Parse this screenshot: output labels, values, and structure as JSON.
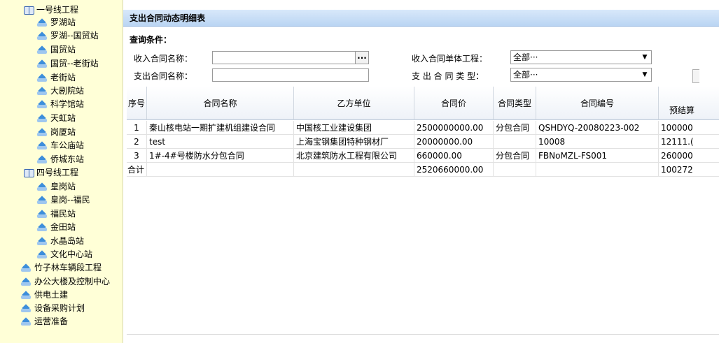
{
  "tree": {
    "items": [
      {
        "label": "一号线工程",
        "type": "folder",
        "level": 0
      },
      {
        "label": "罗湖站",
        "type": "item",
        "level": 1
      },
      {
        "label": "罗湖--国贸站",
        "type": "item",
        "level": 1
      },
      {
        "label": "国贸站",
        "type": "item",
        "level": 1
      },
      {
        "label": "国贸--老街站",
        "type": "item",
        "level": 1
      },
      {
        "label": "老街站",
        "type": "item",
        "level": 1
      },
      {
        "label": "大剧院站",
        "type": "item",
        "level": 1
      },
      {
        "label": "科学馆站",
        "type": "item",
        "level": 1
      },
      {
        "label": "天虹站",
        "type": "item",
        "level": 1
      },
      {
        "label": "岗厦站",
        "type": "item",
        "level": 1
      },
      {
        "label": "车公庙站",
        "type": "item",
        "level": 1
      },
      {
        "label": "侨城东站",
        "type": "item",
        "level": 1
      },
      {
        "label": "四号线工程",
        "type": "folder",
        "level": 0
      },
      {
        "label": "皇岗站",
        "type": "item",
        "level": 1
      },
      {
        "label": "皇岗--福民",
        "type": "item",
        "level": 1
      },
      {
        "label": "福民站",
        "type": "item",
        "level": 1
      },
      {
        "label": "金田站",
        "type": "item",
        "level": 1
      },
      {
        "label": "水晶岛站",
        "type": "item",
        "level": 1
      },
      {
        "label": "文化中心站",
        "type": "item",
        "level": 1
      },
      {
        "label": "竹子林车辆段工程",
        "type": "item",
        "level": 0
      },
      {
        "label": "办公大楼及控制中心",
        "type": "item",
        "level": 0
      },
      {
        "label": "供电土建",
        "type": "item",
        "level": 0
      },
      {
        "label": "设备采购计划",
        "type": "item",
        "level": 0
      },
      {
        "label": "运营准备",
        "type": "item",
        "level": 0
      }
    ]
  },
  "panel": {
    "title": "支出合同动态明细表",
    "query_title": "查询条件：",
    "income_contract_name_label": "收入合同名称：",
    "income_contract_name_value": "",
    "browse_button_label": "...",
    "expense_contract_name_label": "支出合同名称：",
    "expense_contract_name_value": "",
    "income_single_project_label": "收入合同单体工程：",
    "income_single_project_value": "全部···",
    "contract_type_label": "支 出 合 同 类 型：",
    "contract_type_value": "全部···"
  },
  "table": {
    "headers": [
      "序号",
      "合同名称",
      "乙方单位",
      "合同价",
      "合同类型",
      "合同编号",
      "预结算"
    ],
    "rows": [
      [
        "1",
        "秦山核电站一期扩建机组建设合同",
        "中国核工业建设集团",
        "2500000000.00",
        "分包合同",
        "QSHDYQ-20080223-002",
        "100000"
      ],
      [
        "2",
        "test",
        "上海宝钢集团特种钢材厂",
        "20000000.00",
        "",
        "10008",
        "12111.("
      ],
      [
        "3",
        "1#-4#号楼防水分包合同",
        "北京建筑防水工程有限公司",
        "660000.00",
        "分包合同",
        "FBNoMZL-FS001",
        "260000"
      ]
    ],
    "total": [
      "合计",
      "",
      "",
      "2520660000.00",
      "",
      "",
      "100272"
    ]
  },
  "colors": {
    "tree_bg": "#ffffd7",
    "titlebar_bg": "#c8ddf6",
    "icon_blue": "#3d8edb"
  }
}
